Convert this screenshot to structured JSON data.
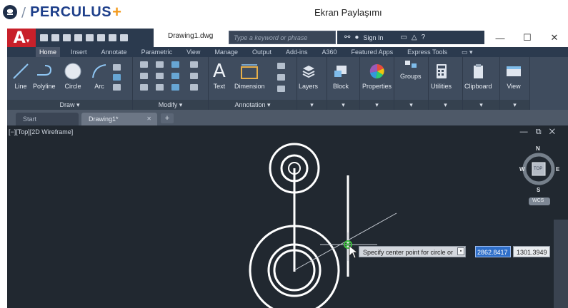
{
  "perculus": {
    "brand": "PERCULUS",
    "brand_plus": "+",
    "share_title": "Ekran Paylaşımı"
  },
  "autocad": {
    "app_button": "A",
    "document_title": "Drawing1.dwg",
    "search_placeholder": "Type a keyword or phrase",
    "sign_in": "Sign In",
    "window_controls": {
      "minimize": "—",
      "maximize": "☐",
      "close": "✕"
    },
    "ribbon_tabs": [
      "Home",
      "Insert",
      "Annotate",
      "Parametric",
      "View",
      "Manage",
      "Output",
      "Add-ins",
      "A360",
      "Featured Apps",
      "Express Tools",
      "▭ ▾"
    ],
    "active_tab": "Home",
    "panels": {
      "draw": {
        "title": "Draw ▾",
        "tools": [
          "Line",
          "Polyline",
          "Circle",
          "Arc"
        ]
      },
      "modify": {
        "title": "Modify ▾"
      },
      "annotation": {
        "title": "Annotation ▾",
        "tools": [
          "Text",
          "Dimension"
        ]
      },
      "layers": {
        "label": "Layers"
      },
      "block": {
        "label": "Block"
      },
      "properties": {
        "label": "Properties"
      },
      "groups": {
        "label": "Groups"
      },
      "utilities": {
        "label": "Utilities"
      },
      "clipboard": {
        "label": "Clipboard"
      },
      "view": {
        "label": "View"
      },
      "dropdown_glyph": "▾"
    },
    "file_tabs": [
      {
        "label": "Start",
        "active": false
      },
      {
        "label": "Drawing1*",
        "active": true
      }
    ],
    "file_tab_close": "✕",
    "new_tab": "+",
    "viewport": {
      "label": "[−][Top][2D Wireframe]",
      "controls": "— ⧉ ✕",
      "viewcube": {
        "north": "N",
        "south": "S",
        "east": "E",
        "west": "W",
        "top": "TOP",
        "ucs": "WCS"
      }
    },
    "command_prompt": {
      "text": "Specify center point for circle or",
      "button": "▪",
      "x_value": "2862.8417",
      "y_value": "1301.3949"
    }
  },
  "colors": {
    "brand_blue": "#1e3f8a",
    "brand_orange": "#f39b1f",
    "autocad_red": "#c8202a",
    "viewport_bg": "#212830",
    "ribbon_bg": "#3f4c5e",
    "snap_marker": "#3fbf3f"
  }
}
